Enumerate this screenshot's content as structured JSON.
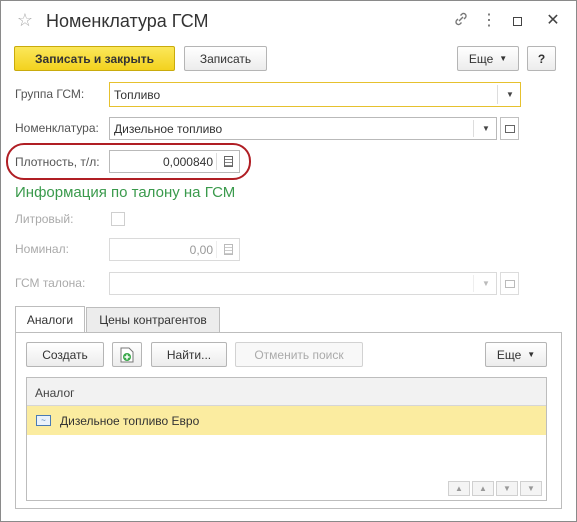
{
  "window": {
    "title": "Номенклатура ГСМ"
  },
  "toolbar": {
    "save_close_label": "Записать и закрыть",
    "save_label": "Записать",
    "more_label": "Еще",
    "help_label": "?"
  },
  "form": {
    "group_label": "Группа ГСМ:",
    "group_value": "Топливо",
    "nomenclature_label": "Номенклатура:",
    "nomenclature_value": "Дизельное топливо",
    "density_label": "Плотность, т/л:",
    "density_value": "0,000840"
  },
  "coupon_section": {
    "title": "Информация по талону на ГСМ",
    "liter_label": "Литровый:",
    "nominal_label": "Номинал:",
    "nominal_value": "0,00",
    "fuel_label": "ГСМ талона:"
  },
  "tabs": [
    {
      "label": "Аналоги",
      "active": true
    },
    {
      "label": "Цены контрагентов",
      "active": false
    }
  ],
  "analogs": {
    "create_label": "Создать",
    "find_label": "Найти...",
    "cancel_search_label": "Отменить поиск",
    "more_label": "Еще",
    "column_header": "Аналог",
    "rows": [
      "Дизельное топливо Евро"
    ]
  },
  "colors": {
    "accent_yellow": "#f3d21e",
    "section_green": "#3a9a4c",
    "highlight_red": "#b01e24",
    "row_selected": "#fbeca0"
  }
}
